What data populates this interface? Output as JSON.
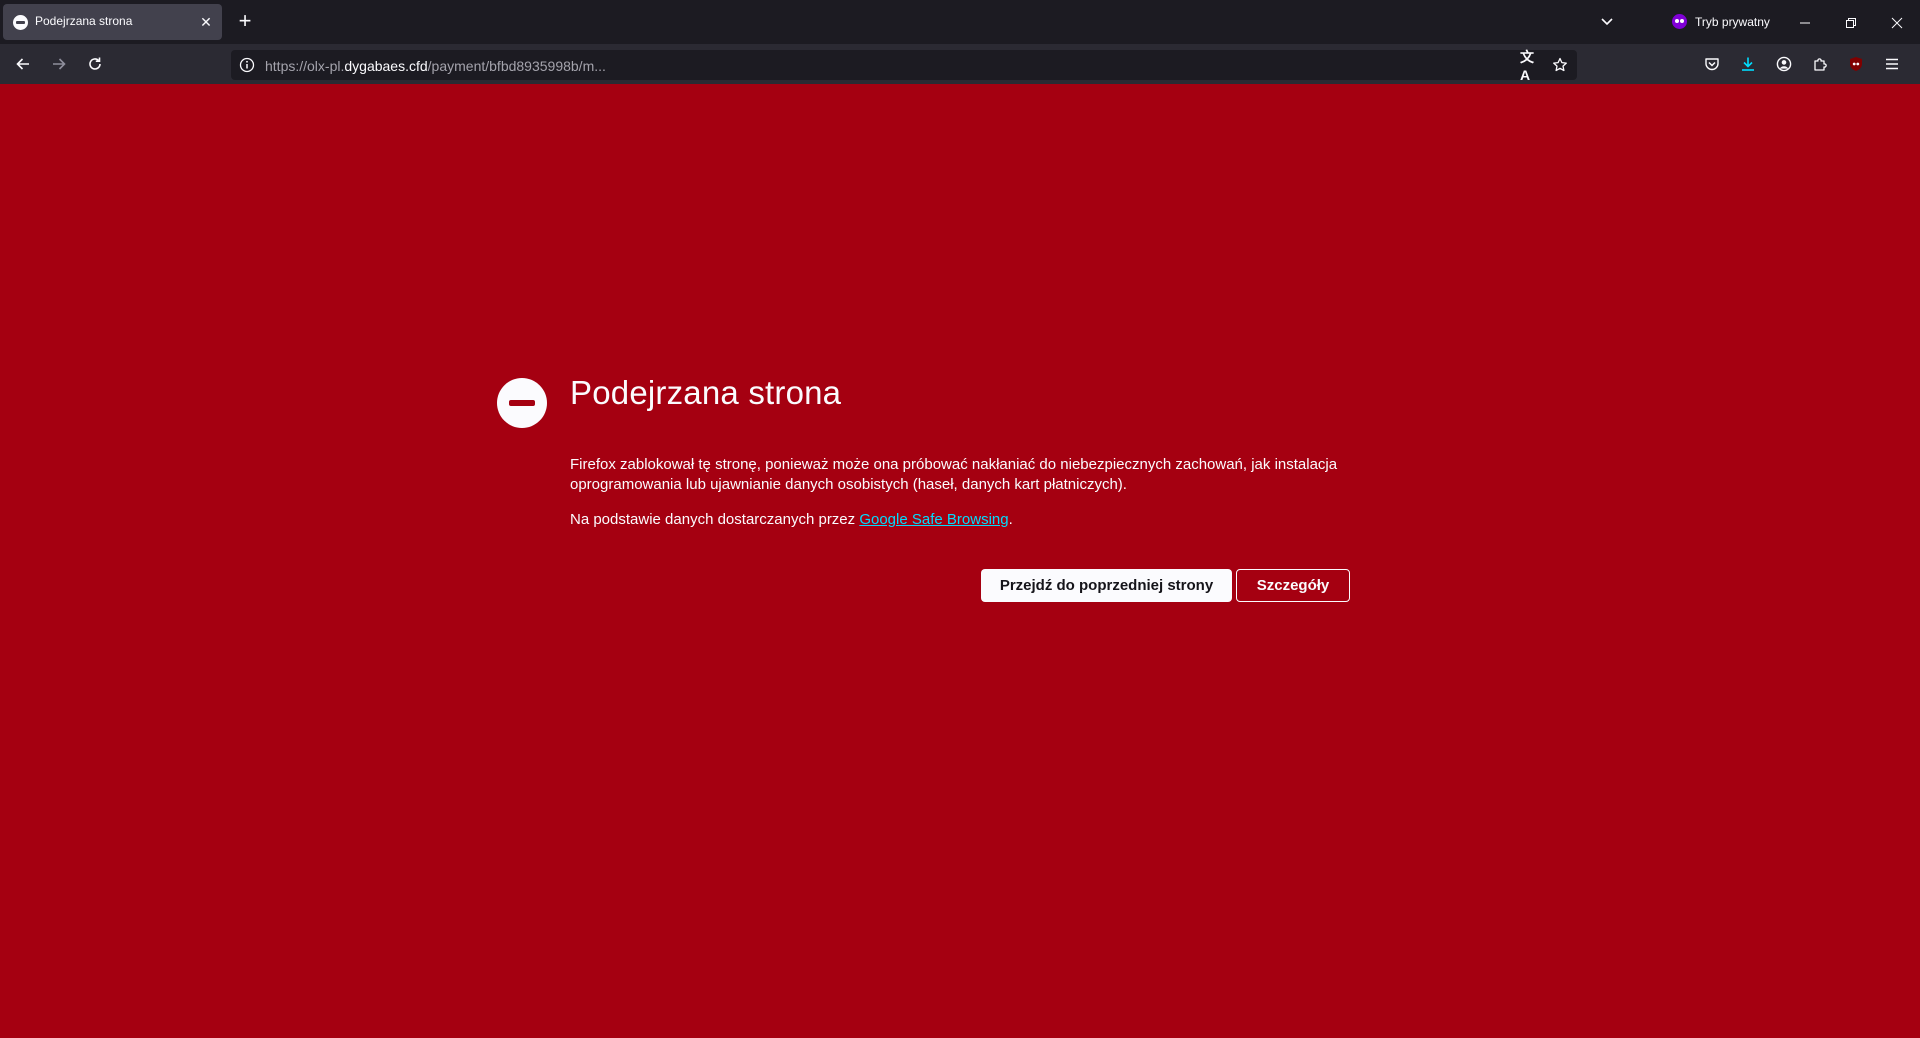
{
  "tab": {
    "title": "Podejrzana strona",
    "favicon": "blocked-icon",
    "close_glyph": "✕"
  },
  "tabstrip": {
    "new_tab_glyph": "+",
    "private_label": "Tryb prywatny"
  },
  "window_controls": {
    "minimize": "—",
    "restore": "❐",
    "close": "✕"
  },
  "urlbar": {
    "url_prefix": "https://olx-pl.",
    "url_domain": "dygabaes.cfd",
    "url_suffix": "/payment/bfbd8935998b/m...",
    "translate_glyph": "文A"
  },
  "error_page": {
    "title": "Podejrzana strona",
    "description": "Firefox zablokował tę stronę, ponieważ może ona próbować nakłaniać do niebezpiecznych zachowań, jak instalacja oprogramowania lub ujawnianie danych osobistych (haseł, danych kart płatniczych).",
    "source_prefix": "Na podstawie danych dostarczanych przez ",
    "source_link": "Google Safe Browsing",
    "source_suffix": ".",
    "go_back_label": "Przejdź do poprzedniej strony",
    "details_label": "Szczegóły"
  },
  "colors": {
    "page_background": "#a50011",
    "tabstrip": "#1c1b22",
    "navbar": "#2b2a33",
    "link": "#00ddff",
    "private_accent": "#8000d7",
    "download_accent": "#00ddff"
  }
}
